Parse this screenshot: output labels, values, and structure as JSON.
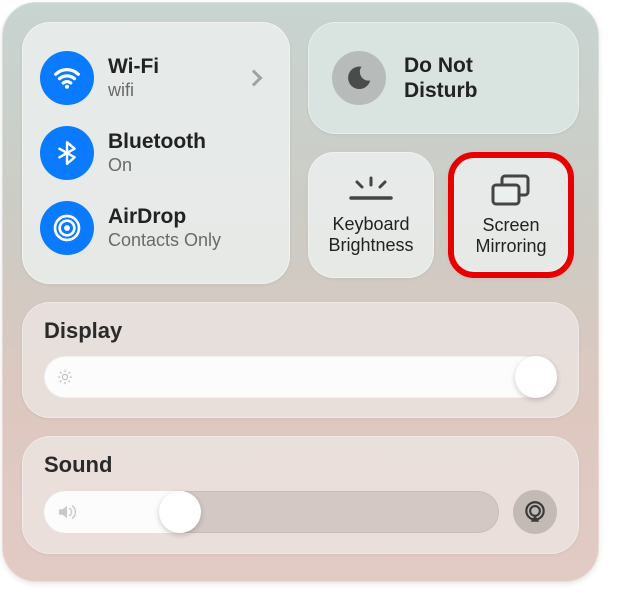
{
  "connectivity": {
    "wifi": {
      "title": "Wi-Fi",
      "sub": "wifi"
    },
    "bluetooth": {
      "title": "Bluetooth",
      "sub": "On"
    },
    "airdrop": {
      "title": "AirDrop",
      "sub": "Contacts Only"
    }
  },
  "dnd": {
    "line1": "Do Not",
    "line2": "Disturb"
  },
  "tiles": {
    "keyboard": {
      "line1": "Keyboard",
      "line2": "Brightness"
    },
    "mirroring": {
      "line1": "Screen",
      "line2": "Mirroring"
    }
  },
  "sliders": {
    "display": {
      "label": "Display",
      "value_pct": 100
    },
    "sound": {
      "label": "Sound",
      "value_pct": 25
    }
  },
  "highlight": "screen-mirroring-tile"
}
